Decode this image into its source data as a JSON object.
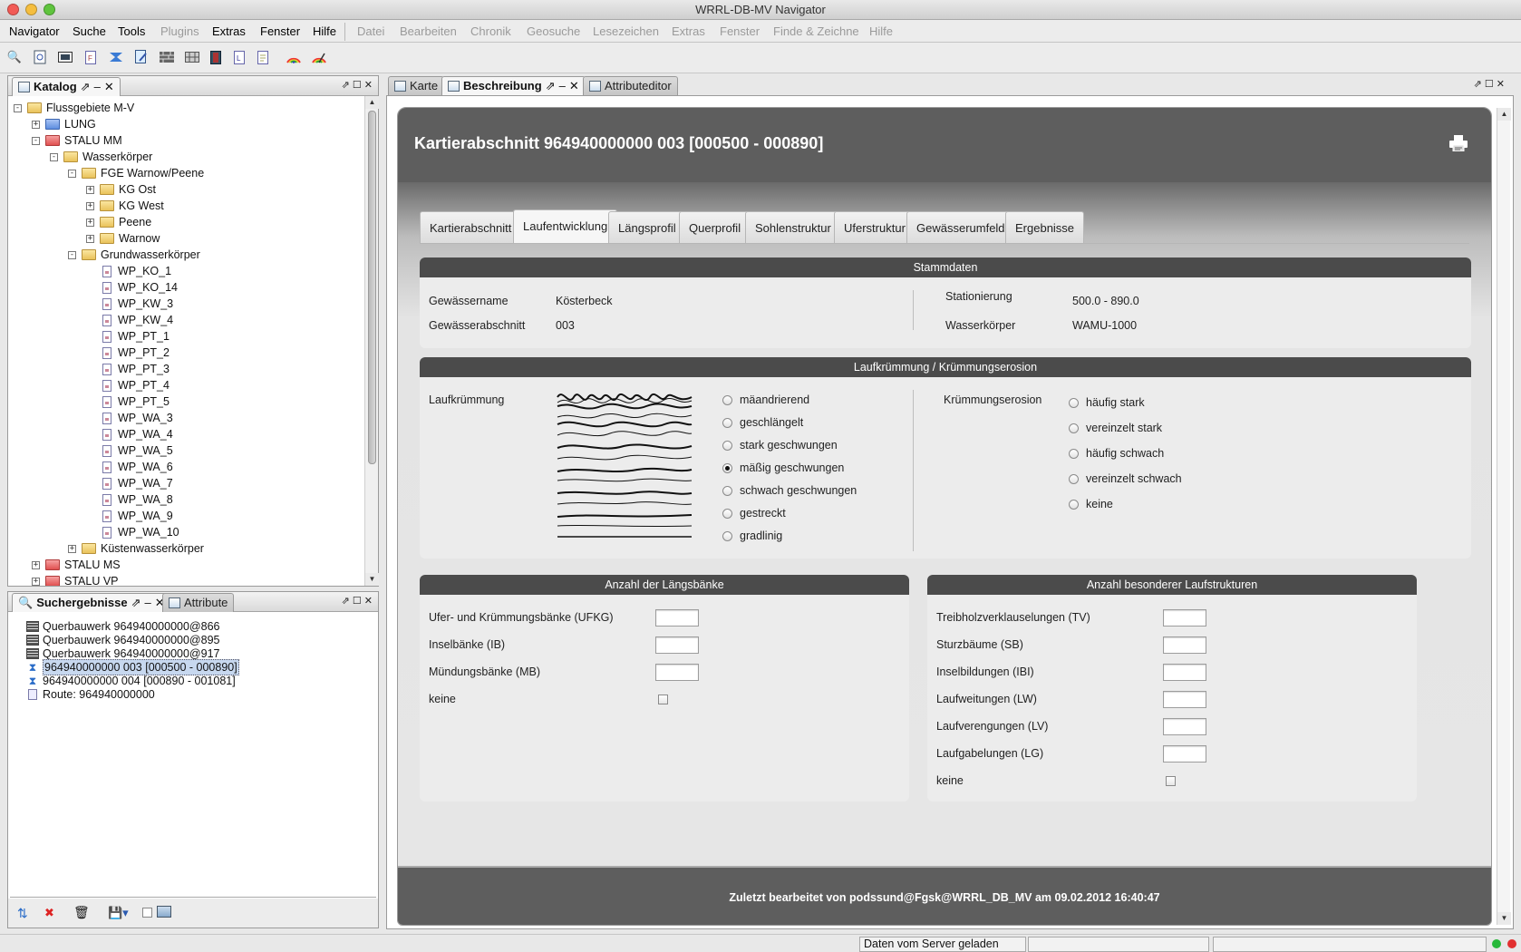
{
  "window": {
    "title": "WRRL-DB-MV Navigator"
  },
  "menu": {
    "items": [
      "Navigator",
      "Suche",
      "Tools",
      "Plugins",
      "Extras",
      "Fenster",
      "Hilfe"
    ],
    "disabled_items": [
      "Datei",
      "Bearbeiten",
      "Chronik",
      "Geosuche",
      "Lesezeichen",
      "Extras",
      "Fenster",
      "Finde & Zeichne",
      "Hilfe"
    ]
  },
  "toolbar": {
    "icons": [
      "search-icon",
      "target-icon",
      "image-icon",
      "document-icon",
      "section-icon",
      "edit-icon",
      "wall-icon",
      "grid-icon",
      "book-icon",
      "layer-icon",
      "page-icon",
      "rainbow-icon",
      "rainbow-edit-icon"
    ]
  },
  "catalog": {
    "tab_label": "Katalog",
    "tree": [
      {
        "label": "Flussgebiete M-V",
        "icon": "yellow",
        "level": 0,
        "exp": "-"
      },
      {
        "label": "LUNG",
        "icon": "blue",
        "level": 1,
        "exp": "+"
      },
      {
        "label": "STALU MM",
        "icon": "red",
        "level": 1,
        "exp": "-"
      },
      {
        "label": "Wasserkörper",
        "icon": "yellow",
        "level": 2,
        "exp": "-"
      },
      {
        "label": "FGE Warnow/Peene",
        "icon": "yellow",
        "level": 3,
        "exp": "-"
      },
      {
        "label": "KG Ost",
        "icon": "yellow",
        "level": 4,
        "exp": "+"
      },
      {
        "label": "KG West",
        "icon": "yellow",
        "level": 4,
        "exp": "+"
      },
      {
        "label": "Peene",
        "icon": "yellow",
        "level": 4,
        "exp": "+"
      },
      {
        "label": "Warnow",
        "icon": "yellow",
        "level": 4,
        "exp": "+"
      },
      {
        "label": "Grundwasserkörper",
        "icon": "yellow",
        "level": 3,
        "exp": "-"
      },
      {
        "label": "WP_KO_1",
        "icon": "doc",
        "level": 4
      },
      {
        "label": "WP_KO_14",
        "icon": "doc",
        "level": 4
      },
      {
        "label": "WP_KW_3",
        "icon": "doc",
        "level": 4
      },
      {
        "label": "WP_KW_4",
        "icon": "doc",
        "level": 4
      },
      {
        "label": "WP_PT_1",
        "icon": "doc",
        "level": 4
      },
      {
        "label": "WP_PT_2",
        "icon": "doc",
        "level": 4
      },
      {
        "label": "WP_PT_3",
        "icon": "doc",
        "level": 4
      },
      {
        "label": "WP_PT_4",
        "icon": "doc",
        "level": 4
      },
      {
        "label": "WP_PT_5",
        "icon": "doc",
        "level": 4
      },
      {
        "label": "WP_WA_3",
        "icon": "doc",
        "level": 4
      },
      {
        "label": "WP_WA_4",
        "icon": "doc",
        "level": 4
      },
      {
        "label": "WP_WA_5",
        "icon": "doc",
        "level": 4
      },
      {
        "label": "WP_WA_6",
        "icon": "doc",
        "level": 4
      },
      {
        "label": "WP_WA_7",
        "icon": "doc",
        "level": 4
      },
      {
        "label": "WP_WA_8",
        "icon": "doc",
        "level": 4
      },
      {
        "label": "WP_WA_9",
        "icon": "doc",
        "level": 4
      },
      {
        "label": "WP_WA_10",
        "icon": "doc",
        "level": 4
      },
      {
        "label": "Küstenwasserkörper",
        "icon": "yellow",
        "level": 3,
        "exp": "+"
      },
      {
        "label": "STALU MS",
        "icon": "red",
        "level": 1,
        "exp": "+"
      },
      {
        "label": "STALU VP",
        "icon": "red",
        "level": 1,
        "exp": "+"
      }
    ]
  },
  "search": {
    "tab_label": "Suchergebnisse",
    "tab2_label": "Attribute",
    "results": [
      {
        "label": "Querbauwerk 964940000000@866",
        "icon": "wall"
      },
      {
        "label": "Querbauwerk 964940000000@895",
        "icon": "wall"
      },
      {
        "label": "Querbauwerk 964940000000@917",
        "icon": "wall"
      },
      {
        "label": "964940000000 003 [000500 - 000890]",
        "icon": "section",
        "selected": true
      },
      {
        "label": "964940000000 004 [000890 - 001081]",
        "icon": "section"
      },
      {
        "label": "Route: 964940000000",
        "icon": "route"
      }
    ]
  },
  "main_tabs": {
    "karte": "Karte",
    "beschreibung": "Beschreibung",
    "attributeditor": "Attributeditor"
  },
  "content": {
    "title": "Kartierabschnitt 964940000000 003 [000500 - 000890]",
    "tabs": [
      "Kartierabschnitt",
      "Laufentwicklung",
      "Längsprofil",
      "Querprofil",
      "Sohlenstruktur",
      "Uferstruktur",
      "Gewässerumfeld",
      "Ergebnisse"
    ],
    "active_tab": "Laufentwicklung",
    "stammdaten": {
      "header": "Stammdaten",
      "gewaessername_label": "Gewässername",
      "gewaessername": "Kösterbeck",
      "abschnitt_label": "Gewässerabschnitt",
      "abschnitt": "003",
      "stationierung_label": "Stationierung",
      "stationierung": "500.0 - 890.0",
      "wasserkoerper_label": "Wasserkörper",
      "wasserkoerper": "WAMU-1000"
    },
    "laufkruemmung": {
      "header": "Laufkrümmung / Krümmungserosion",
      "label": "Laufkrümmung",
      "options": [
        "mäandrierend",
        "geschlängelt",
        "stark geschwungen",
        "mäßig geschwungen",
        "schwach geschwungen",
        "gestreckt",
        "gradlinig"
      ],
      "selected": "mäßig geschwungen",
      "erosion_label": "Krümmungserosion",
      "erosion_options": [
        "häufig stark",
        "vereinzelt stark",
        "häufig schwach",
        "vereinzelt schwach",
        "keine"
      ]
    },
    "laengsbaenke": {
      "header": "Anzahl der Längsbänke",
      "fields": [
        "Ufer- und Krümmungsbänke (UFKG)",
        "Inselbänke (IB)",
        "Mündungsbänke (MB)"
      ],
      "keine_label": "keine"
    },
    "laufstrukturen": {
      "header": "Anzahl besonderer Laufstrukturen",
      "fields": [
        "Treibholzverklauselungen (TV)",
        "Sturzbäume (SB)",
        "Inselbildungen (IBI)",
        "Laufweitungen (LW)",
        "Laufverengungen (LV)",
        "Laufgabelungen (LG)"
      ],
      "keine_label": "keine"
    },
    "footer": "Zuletzt bearbeitet von podssund@Fgsk@WRRL_DB_MV am 09.02.2012 16:40:47"
  },
  "status": {
    "message": "Daten vom Server geladen"
  },
  "colors": {
    "header_dark": "#5e5e5e",
    "section_header": "#4b4b4b",
    "selection": "#c7d8ef"
  }
}
